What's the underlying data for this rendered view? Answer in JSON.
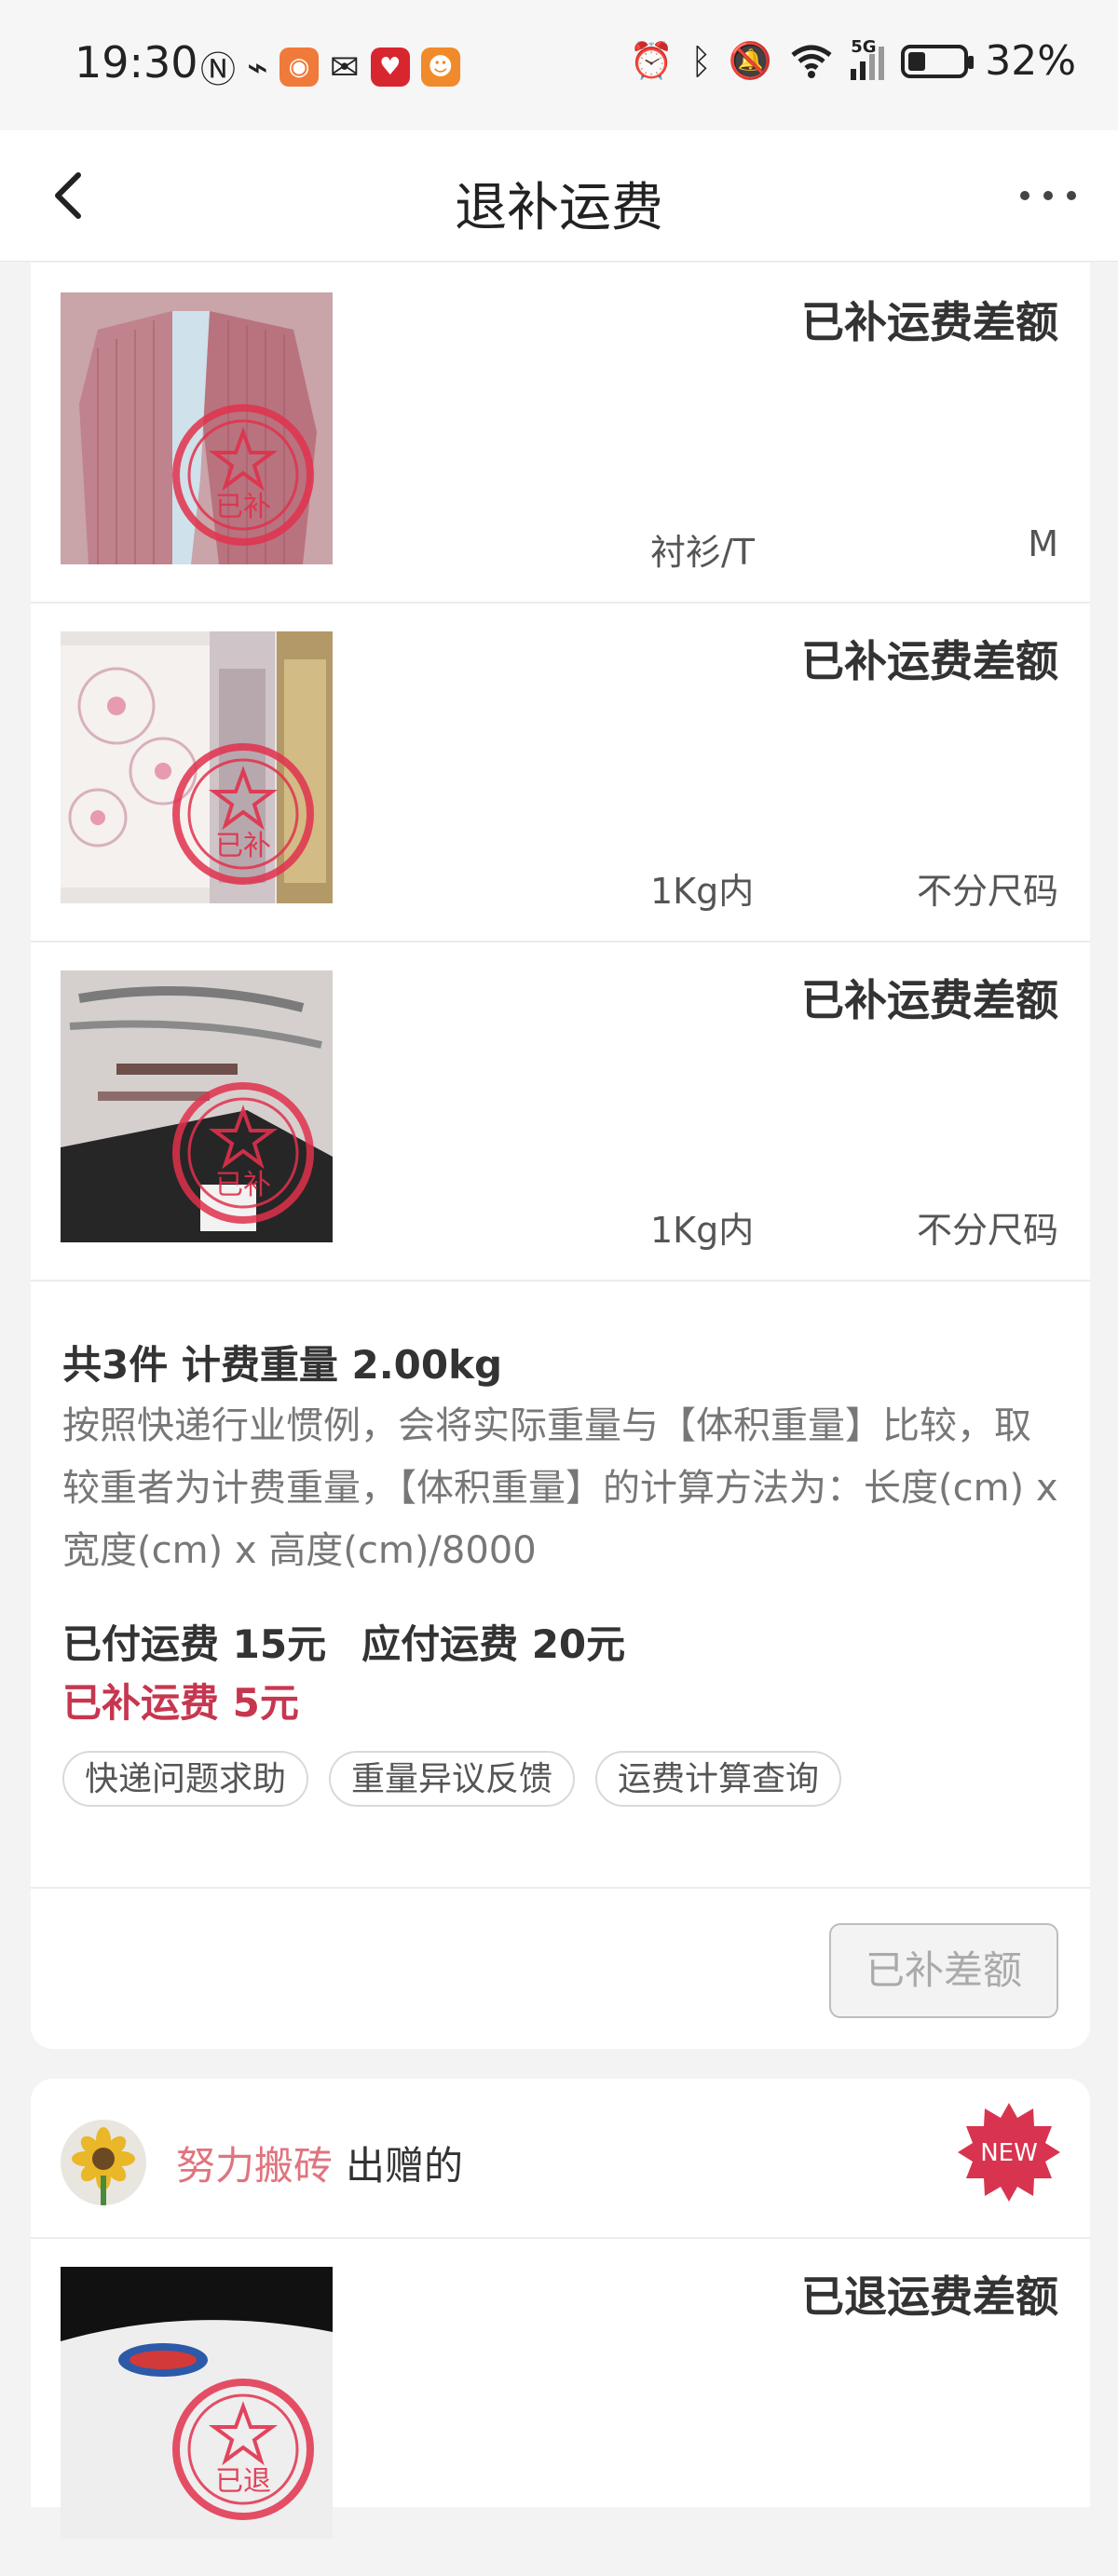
{
  "status_bar": {
    "time": "19:30",
    "battery": "32%",
    "battery_level": 0.32,
    "network": "5G",
    "icons": [
      "nfc-icon",
      "link-icon",
      "app-icon",
      "wechat-icon",
      "app-icon",
      "app-icon",
      "alarm-icon",
      "bluetooth-icon",
      "mute-icon",
      "wifi-icon",
      "signal-icon",
      "battery-icon"
    ]
  },
  "nav": {
    "title": "退补运费",
    "back_icon": "chevron-left-icon",
    "more_icon": "more-icon"
  },
  "items": [
    {
      "status": "已补运费差额",
      "category": "衬衫/T",
      "size": "M",
      "stamp": "已补"
    },
    {
      "status": "已补运费差额",
      "category": "1Kg内",
      "size": "不分尺码",
      "stamp": "已补"
    },
    {
      "status": "已补运费差额",
      "category": "1Kg内",
      "size": "不分尺码",
      "stamp": "已补"
    }
  ],
  "summary": {
    "headline": "共3件 计费重量 2.00kg",
    "description": "按照快递行业惯例，会将实际重量与【体积重量】比较，取较重者为计费重量，【体积重量】的计算方法为：长度(cm) x 宽度(cm) x 高度(cm)/8000",
    "paid": "已付运费 15元",
    "due": "应付运费 20元",
    "extra": "已补运费 5元",
    "extra_color": "#c7364f"
  },
  "chips": [
    "快递问题求助",
    "重量异议反馈",
    "运费计算查询"
  ],
  "done_button": "已补差额",
  "card2": {
    "giver_name": "努力搬砖",
    "giver_suffix": "出赠的",
    "new_badge": "NEW",
    "item_status": "已退运费差额",
    "stamp": "已退"
  }
}
